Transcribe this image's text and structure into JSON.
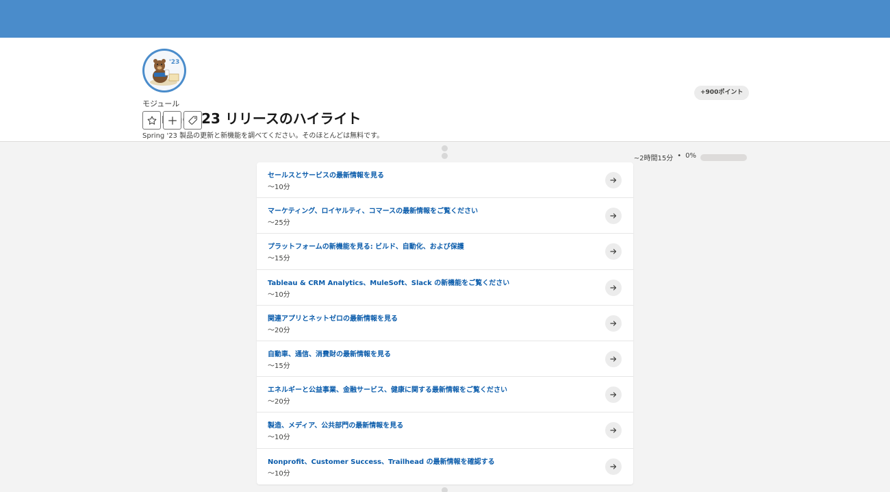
{
  "header": {
    "module_label": "モジュール",
    "title": "Spring '23 リリースのハイライト",
    "description": "Spring '23 製品の更新と新機能を調べてください。そのほとんどは無料です。",
    "points": "+900ポイント",
    "duration": "~2時間15分",
    "separator": "•",
    "progress_text": "0%",
    "progress_value": 0,
    "actions": [
      {
        "icon": "star-icon"
      },
      {
        "icon": "plus-icon"
      },
      {
        "icon": "tag-icon"
      }
    ]
  },
  "units": [
    {
      "title": "セールスとサービスの最新情報を見る",
      "time": "〜10分"
    },
    {
      "title": "マーケティング、ロイヤルティ、コマースの最新情報をご覧ください",
      "time": "〜25分"
    },
    {
      "title": "プラットフォームの新機能を見る: ビルド、自動化、および保護",
      "time": "〜15分"
    },
    {
      "title": "Tableau & CRM Analytics、MuleSoft、Slack の新機能をご覧ください",
      "time": "〜10分"
    },
    {
      "title": "関連アプリとネットゼロの最新情報を見る",
      "time": "〜20分"
    },
    {
      "title": "自動車、通信、消費財の最新情報を見る",
      "time": "〜15分"
    },
    {
      "title": "エネルギーと公益事業、金融サービス、健康に関する最新情報をご覧ください",
      "time": "〜20分"
    },
    {
      "title": "製造、メディア、公共部門の最新情報を見る",
      "time": "〜10分"
    },
    {
      "title": "Nonprofit、Customer Success、Trailhead の最新情報を確認する",
      "time": "〜10分"
    }
  ]
}
